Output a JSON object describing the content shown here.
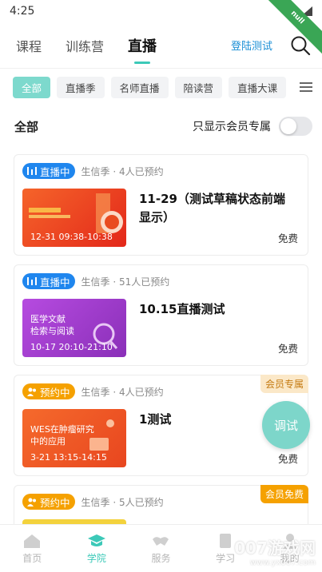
{
  "status": {
    "time": "4:25"
  },
  "top_tabs": [
    "课程",
    "训练营",
    "直播"
  ],
  "active_tab_index": 2,
  "login_test": "登陆测试",
  "chips": [
    "全部",
    "直播季",
    "名师直播",
    "陪读营",
    "直播大课"
  ],
  "section": {
    "title": "全部",
    "vip_only_label": "只显示会员专属"
  },
  "cards": [
    {
      "status": "直播中",
      "status_kind": "live",
      "meta": "生信季 · 4人已预约",
      "title": "11-29（测试草稿状态前端显示）",
      "price": "免费",
      "thumb_time": "12-31 09:38-10:38",
      "thumb_text": "",
      "thumb_color": "#f04a1f",
      "vip": ""
    },
    {
      "status": "直播中",
      "status_kind": "live",
      "meta": "生信季 · 51人已预约",
      "title": "10.15直播测试",
      "price": "免费",
      "thumb_time": "10-17 20:10-21:10",
      "thumb_text": "医学文献\n检索与阅读",
      "thumb_color": "#9c3cc6",
      "vip": ""
    },
    {
      "status": "预约中",
      "status_kind": "reserve",
      "meta": "生信季 · 4人已预约",
      "title": "1测试",
      "price": "免费",
      "thumb_time": "3-21 13:15-14:15",
      "thumb_text": "WES在肿瘤研究\n中的应用",
      "thumb_color": "#f0592a",
      "vip": "会员专属"
    },
    {
      "status": "预约中",
      "status_kind": "reserve",
      "meta": "生信季 · 5人已预约",
      "title": "",
      "price": "",
      "thumb_time": "",
      "thumb_text": "",
      "thumb_color": "#f3d23c",
      "vip": "会员免费"
    }
  ],
  "float_button": "调试",
  "bottom_nav": [
    "首页",
    "学院",
    "服务",
    "学习",
    "我的"
  ],
  "bottom_nav_active": 1,
  "watermark": {
    "main": "007游戏网",
    "sub": "www.yx007.com"
  },
  "colors": {
    "accent": "#3cc9b8",
    "live": "#1f86ee",
    "reserve": "#f5a100"
  }
}
